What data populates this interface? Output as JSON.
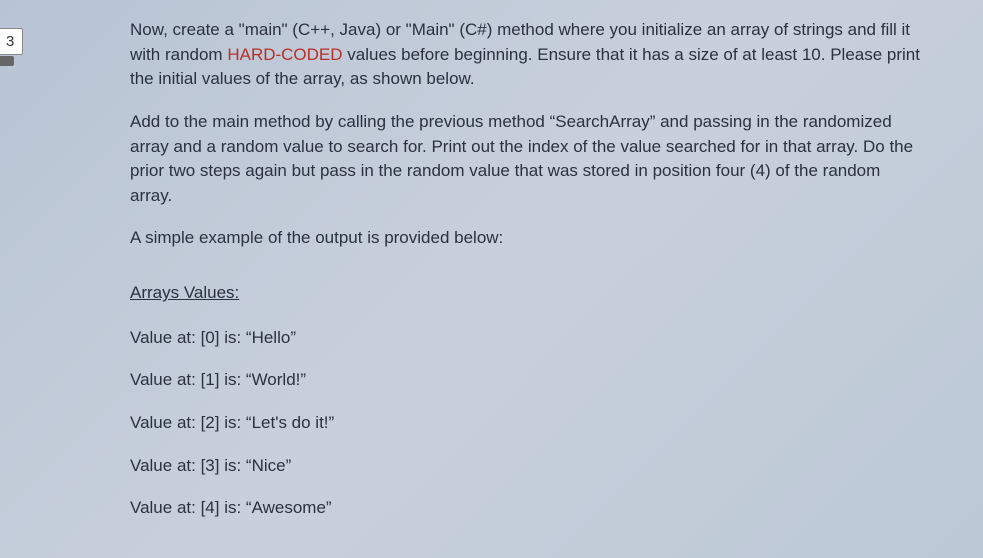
{
  "page_number": "3",
  "paragraphs": {
    "p1_part1": "Now, create a \"main\" (C++, Java) or \"Main\" (C#) method where you initialize an array of strings and fill it with random ",
    "p1_highlight": "HARD-CODED",
    "p1_part2": " values before beginning. Ensure that it has a size of at least 10. Please print the initial values of the array, as shown below.",
    "p2": "Add to the main method by calling the previous method “SearchArray” and passing in the randomized array and a random value to search for. Print out the index of the value searched for in that array. Do the prior two steps again but pass in the random value that was stored in position four (4) of the random array.",
    "p3": "A simple example of the output is provided below:"
  },
  "output": {
    "title": "Arrays Values:",
    "lines": {
      "l0": "Value at: [0] is: “Hello”",
      "l1": "Value at: [1] is: “World!”",
      "l2": "Value at: [2] is: “Let's do it!”",
      "l3": "Value at: [3] is: “Nice”",
      "l4": "Value at: [4] is: “Awesome”"
    }
  }
}
